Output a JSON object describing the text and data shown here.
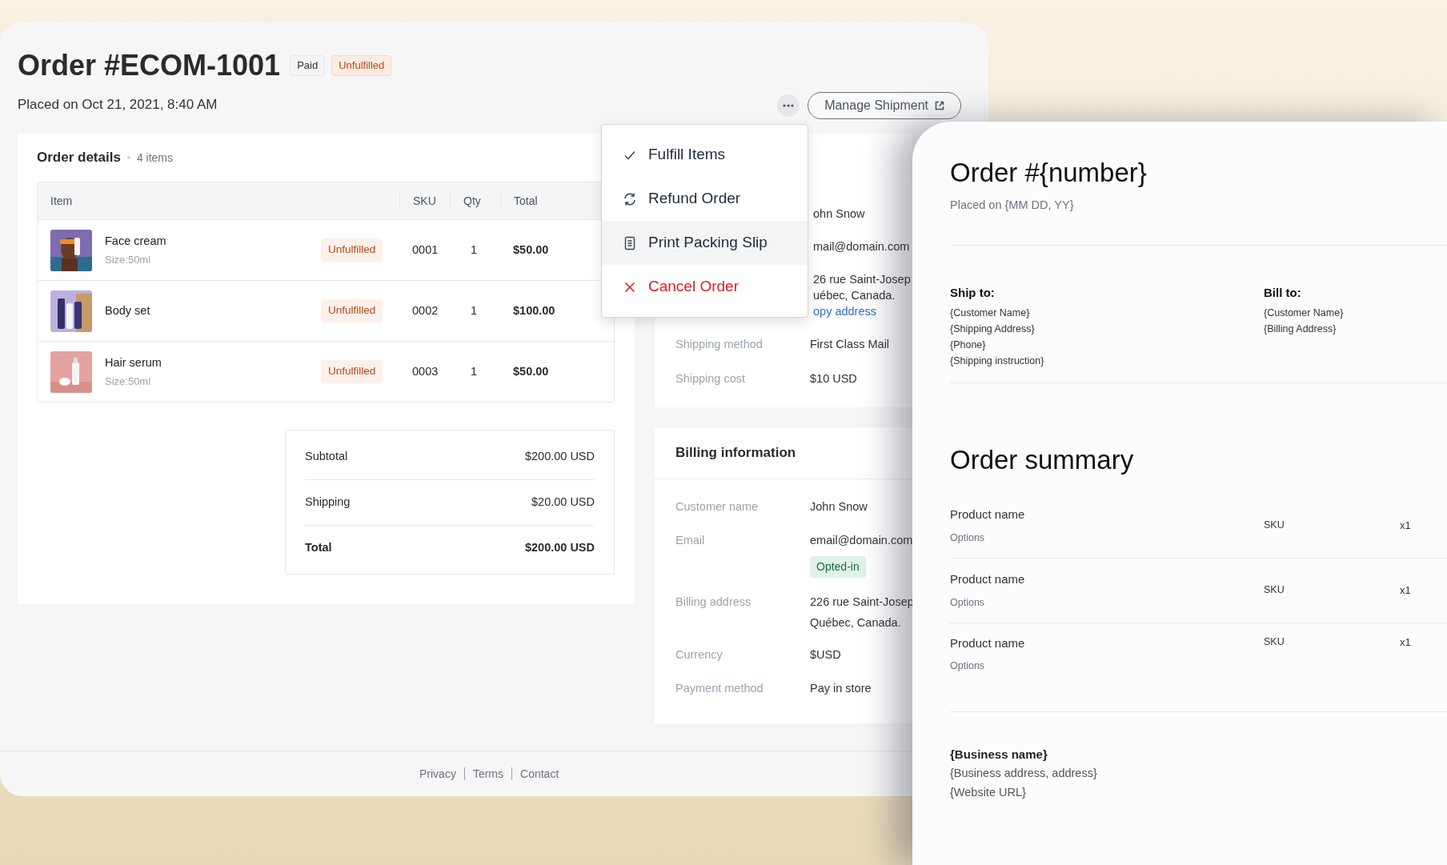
{
  "header": {
    "title": "Order #ECOM-1001",
    "badges": [
      {
        "label": "Paid",
        "kind": "neutral"
      },
      {
        "label": "Unfulfilled",
        "kind": "warning"
      }
    ],
    "placed": "Placed on Oct 21, 2021, 8:40 AM",
    "manage_button": "Manage Shipment"
  },
  "order_details": {
    "title": "Order details",
    "count": "4 items",
    "columns": [
      "Item",
      "SKU",
      "Qty",
      "Total"
    ],
    "rows": [
      {
        "name": "Face cream",
        "option": "Size:50ml",
        "status": "Unfulfilled",
        "sku": "0001",
        "qty": "1",
        "total": "$50.00"
      },
      {
        "name": "Body set",
        "status": "Unfulfilled",
        "sku": "0002",
        "qty": "1",
        "total": "$100.00"
      },
      {
        "name": "Hair serum",
        "option": "Size:50ml",
        "status": "Unfulfilled",
        "sku": "0003",
        "qty": "1",
        "total": "$50.00"
      }
    ],
    "summary": [
      {
        "label": "Subtotal",
        "value": "$200.00 USD",
        "kind": "line"
      },
      {
        "label": "Shipping",
        "value": "$20.00 USD",
        "kind": "line"
      },
      {
        "label": "Total",
        "value": "$200.00 USD",
        "kind": "total"
      }
    ]
  },
  "menu": {
    "items": [
      {
        "label": "Fulfill Items",
        "kind": "check",
        "selected": false
      },
      {
        "label": "Refund Order",
        "kind": "refresh",
        "selected": false
      },
      {
        "label": "Print Packing Slip",
        "kind": "document",
        "selected": true
      },
      {
        "label": "Cancel Order",
        "kind": "cancel",
        "selected": false
      }
    ]
  },
  "shipping": {
    "rows": [
      {
        "values": [
          "ohn Snow"
        ]
      },
      {
        "values": [
          "mail@domain.com"
        ]
      },
      {
        "values": [
          "26 rue Saint-Josep",
          "uébec, Canada."
        ],
        "link": "opy address"
      },
      {
        "label": "Shipping method",
        "values": [
          "First Class Mail"
        ]
      },
      {
        "label": "Shipping cost",
        "values": [
          "$10 USD"
        ]
      }
    ]
  },
  "billing": {
    "title": "Billing information",
    "rows": [
      {
        "label": "Customer name",
        "values": [
          "John Snow"
        ]
      },
      {
        "label": "Email",
        "values": [
          "email@domain.com"
        ],
        "badge": "Opted-in"
      },
      {
        "label": "Billing address",
        "values": [
          "226 rue Saint-Josep",
          "Québec, Canada."
        ]
      },
      {
        "label": "Currency",
        "values": [
          "$USD"
        ]
      },
      {
        "label": "Payment method",
        "values": [
          "Pay in store"
        ]
      }
    ]
  },
  "footer": {
    "links": [
      "Privacy",
      "Terms",
      "Contact"
    ]
  },
  "document": {
    "title": "Order #{number}",
    "placed": "Placed on {MM DD, YY}",
    "ship_to": {
      "heading": "Ship to:",
      "lines": [
        "{Customer Name}",
        "{Shipping Address}",
        "{Phone}",
        "{Shipping instruction}"
      ]
    },
    "bill_to": {
      "heading": "Bill to:",
      "lines": [
        "{Customer Name}",
        "{Billing Address}"
      ]
    },
    "summary_title": "Order summary",
    "items": [
      {
        "name": "Product name",
        "options": "Options",
        "sku": "SKU",
        "qty": "x1"
      },
      {
        "name": "Product name",
        "options": "Options",
        "sku": "SKU",
        "qty": "x1"
      },
      {
        "name": "Product name",
        "options": "Options",
        "sku": "SKU",
        "qty": "x1"
      }
    ],
    "business": {
      "name": "{Business name}",
      "lines": [
        "{Business address, address}",
        "{Website URL}"
      ]
    }
  }
}
